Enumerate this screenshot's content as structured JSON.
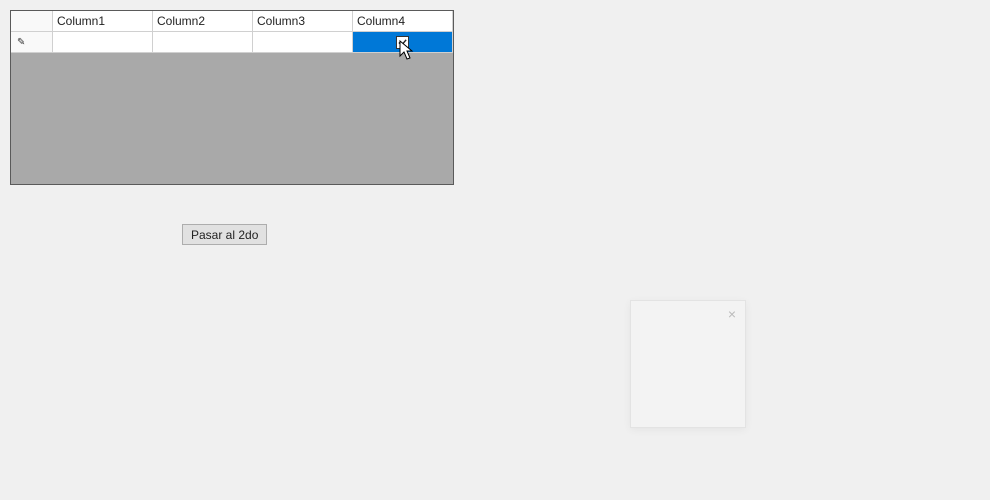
{
  "grid": {
    "columns": [
      "Column1",
      "Column2",
      "Column3",
      "Column4"
    ],
    "rows": [
      {
        "editIndicator": "✎",
        "cells": [
          "",
          "",
          "",
          ""
        ],
        "selectedCol": 3,
        "checkboxChecked": true
      }
    ]
  },
  "button": {
    "label": "Pasar al 2do"
  },
  "popup": {
    "closeGlyph": "×"
  }
}
